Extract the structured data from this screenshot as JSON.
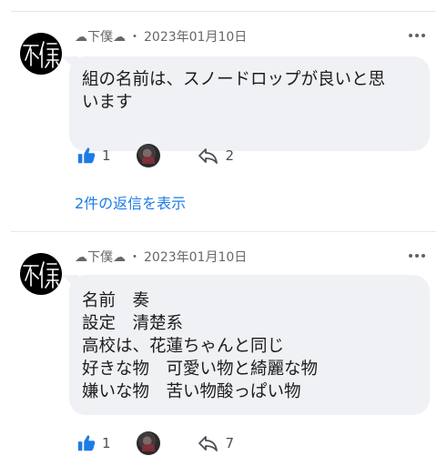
{
  "comments": [
    {
      "author": "☁下僕☁",
      "date": "2023年01月10日",
      "body_lines": [
        "組の名前は、スノードロップが良いと思",
        "います"
      ],
      "likes": "1",
      "replies": "2"
    },
    {
      "author": "☁下僕☁",
      "date": "2023年01月10日",
      "body_lines": [
        "名前　奏",
        "設定　清楚系",
        "高校は、花蓮ちゃんと同じ",
        "好きな物　可愛い物と綺麗な物",
        "嫌いな物　苦い物酸っぱい物"
      ],
      "likes": "1",
      "replies": "7"
    }
  ],
  "show_replies": "2件の返信を表示",
  "separator": "・",
  "icons": {
    "avatar": "avatar-kanji-icon",
    "more": "more-dots-icon",
    "like": "thumbs-up-icon",
    "reply": "reply-arrow-icon"
  },
  "colors": {
    "accent": "#1c7ce6",
    "bubble": "#f0f1f4",
    "meta_text": "#65676b"
  }
}
